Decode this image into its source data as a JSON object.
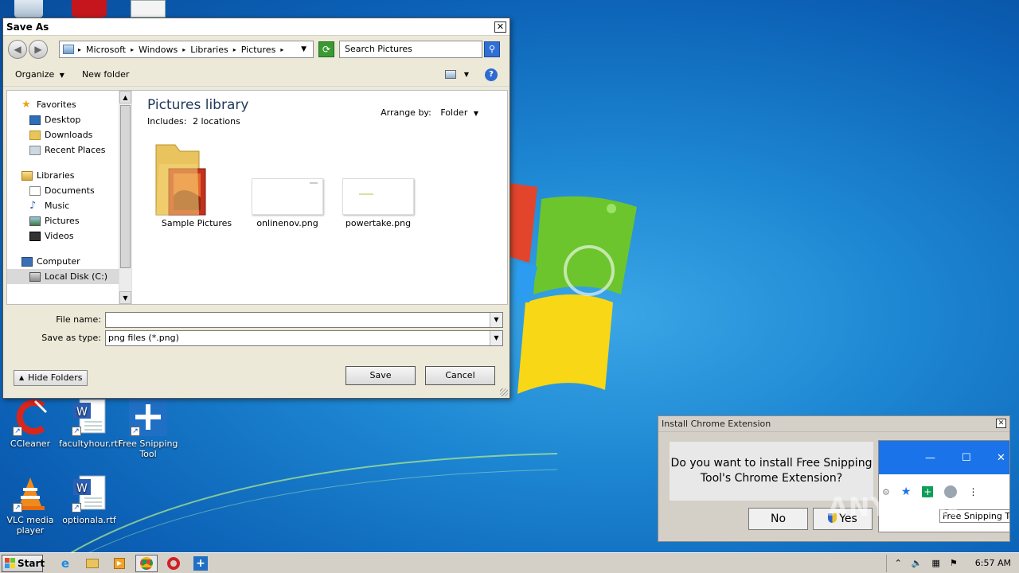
{
  "desktop": {
    "icons": [
      {
        "label": "CCleaner"
      },
      {
        "label": "facultyhour.rtf"
      },
      {
        "label": "Free Snipping Tool"
      },
      {
        "label": "VLC media player"
      },
      {
        "label": "optionala.rtf"
      }
    ]
  },
  "save_dialog": {
    "title": "Save As",
    "close": "✕",
    "back": "◀",
    "forward": "▶",
    "address": [
      "Microsoft",
      "Windows",
      "Libraries",
      "Pictures"
    ],
    "search_placeholder": "Search Pictures",
    "toolbar": {
      "organize": "Organize",
      "new_folder": "New folder",
      "help": "?"
    },
    "tree": {
      "favorites": "Favorites",
      "desktop": "Desktop",
      "downloads": "Downloads",
      "recent_places": "Recent Places",
      "libraries": "Libraries",
      "documents": "Documents",
      "music": "Music",
      "pictures": "Pictures",
      "videos": "Videos",
      "computer": "Computer",
      "local_disk": "Local Disk (C:)"
    },
    "library_title": "Pictures library",
    "library_includes_label": "Includes:",
    "library_includes_link": "2 locations",
    "arrange_by_label": "Arrange by:",
    "arrange_by_value": "Folder",
    "files": [
      {
        "name": "Sample Pictures"
      },
      {
        "name": "onlinenov.png"
      },
      {
        "name": "powertake.png"
      }
    ],
    "file_name_label": "File name:",
    "file_name_value": "",
    "save_type_label": "Save as type:",
    "save_type_value": "png files (*.png)",
    "save_button": "Save",
    "cancel_button": "Cancel",
    "hide_folders": "Hide Folders"
  },
  "extension_popup": {
    "title": "Install Chrome Extension",
    "close": "✕",
    "message": "Do you want to install Free Snipping Tool's Chrome Extension?",
    "no_button": "No",
    "yes_button": "Yes",
    "preview_tooltip": "Free Snipping To"
  },
  "watermark": "ANY.RUN",
  "taskbar": {
    "start": "Start",
    "clock": "6:57 AM"
  },
  "colors": {
    "desktop_blue": "#1d86d2",
    "dialog_bg": "#ece9d8",
    "chrome_blue": "#1a73e8"
  }
}
